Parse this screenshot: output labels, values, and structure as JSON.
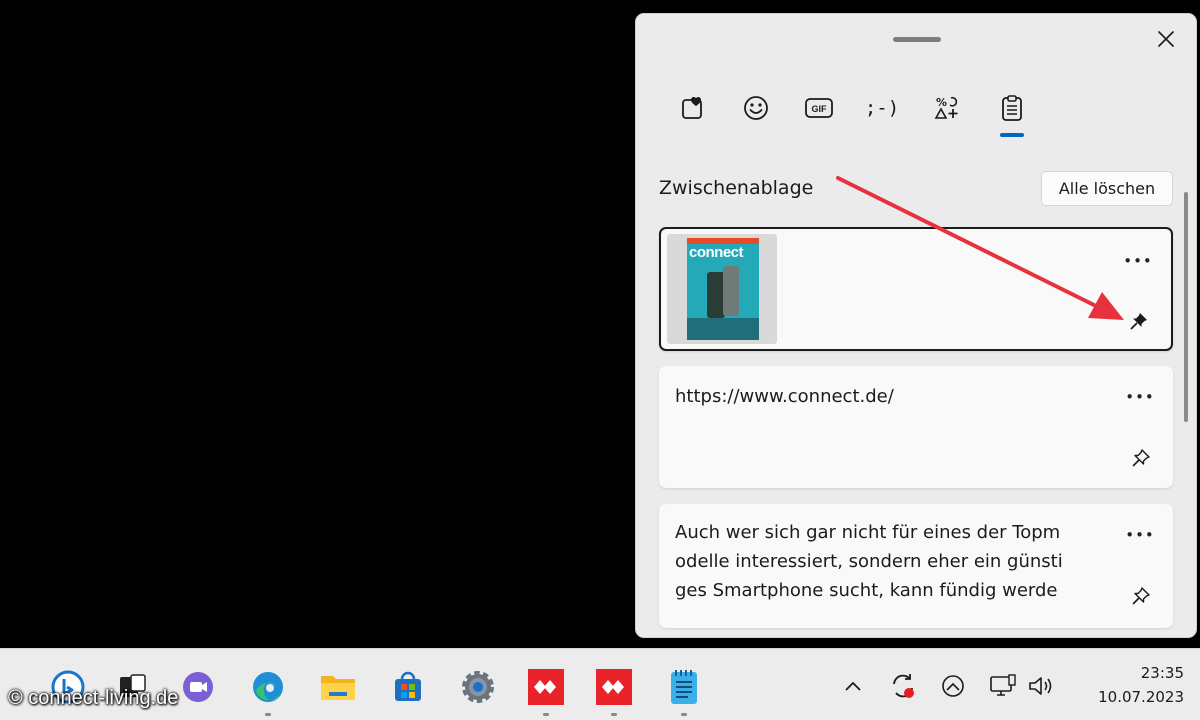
{
  "panel": {
    "close_icon": "close-icon",
    "tabs": [
      {
        "icon": "favorites-icon"
      },
      {
        "icon": "emoji-icon"
      },
      {
        "icon": "gif-icon",
        "label": "GIF"
      },
      {
        "icon": "kaomoji-icon",
        "label": ";-)"
      },
      {
        "icon": "symbols-icon"
      },
      {
        "icon": "clipboard-icon",
        "selected": true
      }
    ],
    "section_title": "Zwischenablage",
    "clear_all_label": "Alle löschen",
    "items": [
      {
        "type": "image",
        "thumbnail_text": "connect",
        "selected": true
      },
      {
        "type": "text",
        "text": "https://www.connect.de/"
      },
      {
        "type": "text",
        "lines": [
          "Auch wer sich gar nicht für eines der Topm",
          "odelle interessiert, sondern eher ein günsti",
          "ges Smartphone sucht, kann fündig werde"
        ]
      }
    ],
    "accent_color": "#0067c0",
    "annotation_arrow_color": "#e8313f"
  },
  "taskbar": {
    "apps": [
      {
        "icon": "bing-icon"
      },
      {
        "icon": "task-view-icon"
      },
      {
        "icon": "teams-chat-icon"
      },
      {
        "icon": "edge-icon"
      },
      {
        "icon": "file-explorer-icon"
      },
      {
        "icon": "microsoft-store-icon"
      },
      {
        "icon": "settings-icon"
      },
      {
        "icon": "anydesk-icon"
      },
      {
        "icon": "anydesk-icon"
      },
      {
        "icon": "notepad-icon"
      }
    ],
    "tray": [
      "chevron-up-icon",
      "sync-icon",
      "onedrive-icon",
      "network-icon",
      "volume-icon"
    ],
    "time": "23:35",
    "date": "10.07.2023"
  },
  "watermark": "© connect-living.de"
}
